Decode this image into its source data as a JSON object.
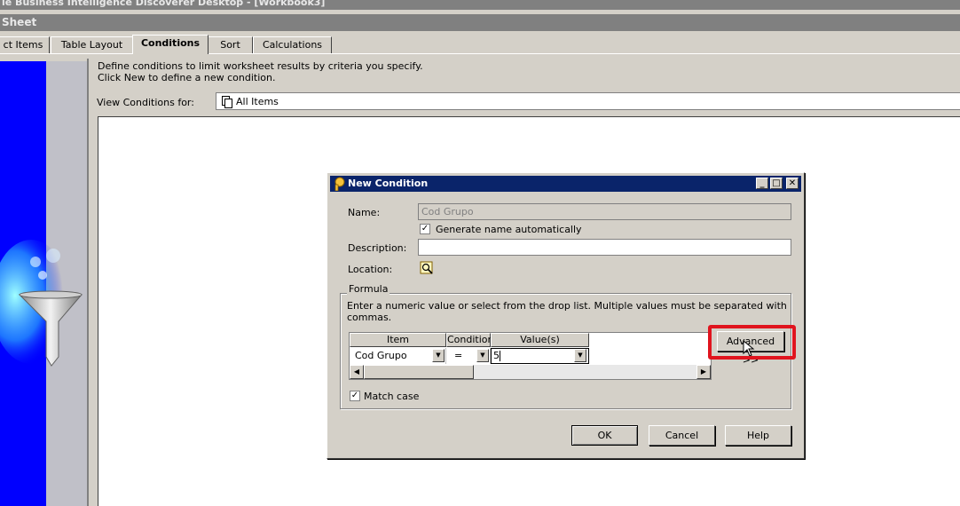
{
  "window": {
    "title": "le Business Intelligence Discoverer Desktop - [Workbook3]",
    "sheet_label": "Sheet"
  },
  "tabs": [
    {
      "label": "ct Items"
    },
    {
      "label": "Table Layout"
    },
    {
      "label": "Conditions",
      "active": true
    },
    {
      "label": "Sort"
    },
    {
      "label": "Calculations"
    }
  ],
  "conditions_panel": {
    "description": "Define conditions to limit worksheet results by criteria you specify. Click New to define a new condition.",
    "view_conditions_label": "View Conditions for:",
    "view_conditions_value": "All Items"
  },
  "dialog": {
    "title": "New Condition",
    "name_label": "Name:",
    "name_value": "Cod Grupo",
    "generate_name_label": "Generate name automatically",
    "generate_name_checked": true,
    "description_label": "Description:",
    "description_value": "",
    "location_label": "Location:",
    "formula_legend": "Formula",
    "formula_hint": "Enter a numeric value or select from the drop list. Multiple values must be separated with commas.",
    "grid": {
      "headers": [
        "Item",
        "Condition",
        "Value(s)"
      ],
      "row": {
        "item": "Cod Grupo",
        "condition": "=",
        "value": "5"
      }
    },
    "advanced_label": "Advanced >>",
    "match_case_label": "Match case",
    "match_case_checked": true,
    "ok_label": "OK",
    "cancel_label": "Cancel",
    "help_label": "Help"
  },
  "colors": {
    "highlight": "#e0141e",
    "dialog_title": "#0a246a",
    "left_panel_blue": "#0000ff"
  }
}
